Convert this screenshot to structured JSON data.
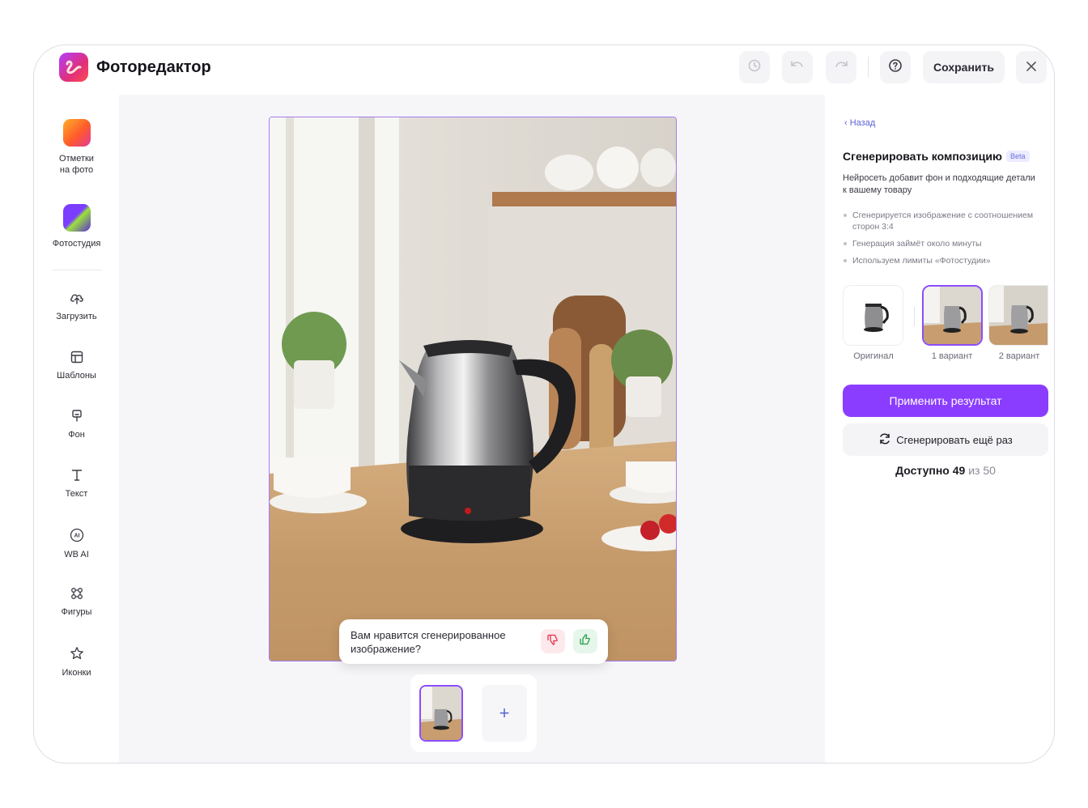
{
  "header": {
    "title": "Фоторедактор",
    "save_label": "Сохранить"
  },
  "icons": {
    "history": "history-icon",
    "undo": "undo-icon",
    "redo": "redo-icon",
    "help": "help-icon",
    "close": "close-icon"
  },
  "sidebar": {
    "items": [
      {
        "label": "Отметки\nна фото",
        "icon": "marks-icon"
      },
      {
        "label": "Фотостудия",
        "icon": "photostudio-icon"
      },
      {
        "label": "Загрузить",
        "icon": "upload-icon"
      },
      {
        "label": "Шаблоны",
        "icon": "templates-icon"
      },
      {
        "label": "Фон",
        "icon": "background-icon"
      },
      {
        "label": "Текст",
        "icon": "text-icon"
      },
      {
        "label": "WB AI",
        "icon": "ai-icon"
      },
      {
        "label": "Фигуры",
        "icon": "shapes-icon"
      },
      {
        "label": "Иконки",
        "icon": "star-icon"
      }
    ]
  },
  "canvas": {
    "feedback_question": "Вам нравится сгенерированное изображение?",
    "add_label": "+"
  },
  "panel": {
    "back_label": "Назад",
    "title": "Сгенерировать композицию",
    "badge": "Beta",
    "description": "Нейросеть добавит фон и подходящие детали к вашему товару",
    "bullets": [
      "Сгенерируется изображение с соотношением сторон 3:4",
      "Генерация займёт около минуты",
      "Используем лимиты «Фотостудии»"
    ],
    "variants": [
      {
        "label": "Оригинал"
      },
      {
        "label": "1 вариант"
      },
      {
        "label": "2 вариант"
      }
    ],
    "apply_label": "Применить результат",
    "regenerate_label": "Сгенерировать ещё раз",
    "available_prefix": "Доступно",
    "available_count": "49",
    "available_of": "из 50"
  },
  "colors": {
    "accent": "#8b3dff",
    "link": "#5a63d8"
  }
}
